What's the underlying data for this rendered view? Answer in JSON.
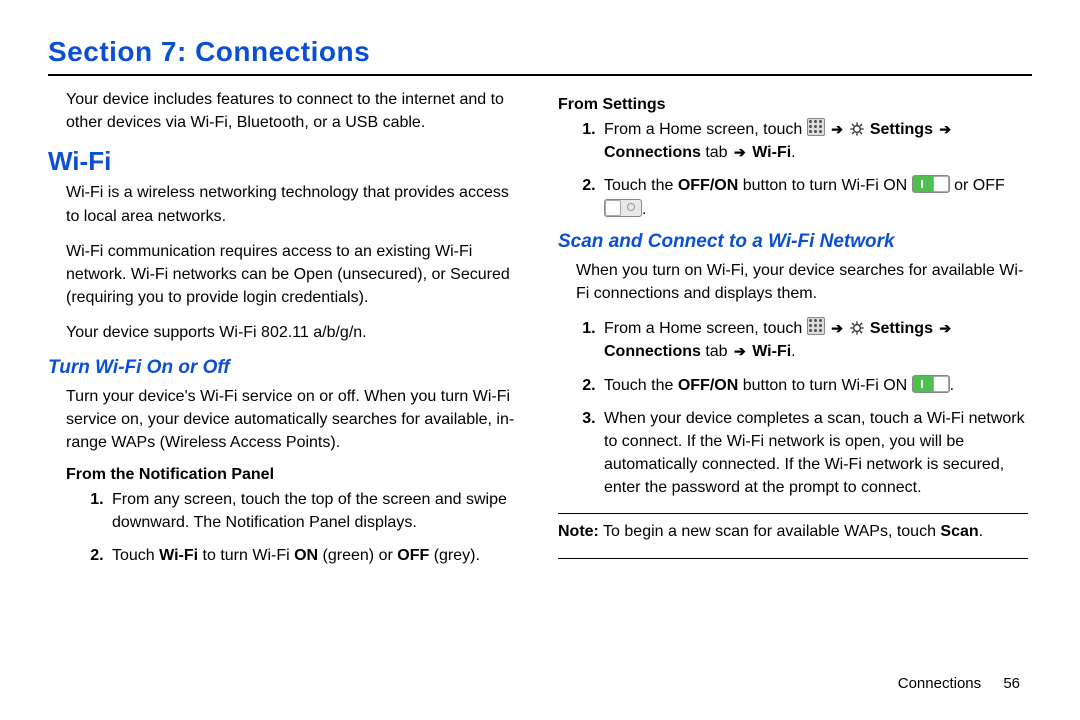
{
  "header": {
    "title": "Section 7: Connections"
  },
  "left": {
    "intro": "Your device includes features to connect to the internet and to other devices via Wi-Fi, Bluetooth, or a USB cable.",
    "wifi_heading": "Wi-Fi",
    "wifi_p1": "Wi-Fi is a wireless networking technology that provides access to local area networks.",
    "wifi_p2": "Wi-Fi communication requires access to an existing Wi-Fi network. Wi-Fi networks can be Open (unsecured), or Secured (requiring you to provide login credentials).",
    "wifi_p3": "Your device supports Wi-Fi 802.11 a/b/g/n.",
    "turn_heading": "Turn Wi-Fi On or Off",
    "turn_p": "Turn your device's Wi-Fi service on or off. When you turn Wi-Fi service on, your device automatically searches for available, in-range WAPs (Wireless Access Points).",
    "notif_heading": "From the Notification Panel",
    "notif_step1": "From any screen, touch the top of the screen and swipe downward. The Notification Panel displays.",
    "notif_step2_a": "Touch ",
    "notif_step2_b": "Wi-Fi",
    "notif_step2_c": " to turn Wi-Fi ",
    "notif_step2_on": "ON",
    "notif_step2_d": " (green) or ",
    "notif_step2_off": "OFF",
    "notif_step2_e": " (grey)."
  },
  "right": {
    "settings_heading": "From Settings",
    "settings_step1_a": "From a Home screen, touch ",
    "settings_step1_b": " Settings ",
    "settings_step1_c2": "Connections",
    "settings_step1_c3": " tab ",
    "settings_step1_d": " Wi-Fi",
    "settings_step2_a": "Touch the ",
    "settings_step2_b": "OFF/ON",
    "settings_step2_c": " button to turn Wi-Fi ON ",
    "settings_step2_d": " or OFF ",
    "scan_heading": "Scan and Connect to a Wi-Fi Network",
    "scan_p": "When you turn on Wi-Fi, your device searches for available Wi-Fi connections and displays them.",
    "scan_step1_a": "From a Home screen, touch ",
    "scan_step1_b": " Settings ",
    "scan_step1_c2": "Connections",
    "scan_step1_c3": " tab ",
    "scan_step1_d": " Wi-Fi",
    "scan_step2_a": "Touch the ",
    "scan_step2_b": "OFF/ON",
    "scan_step2_c": " button to turn Wi-Fi ON ",
    "scan_step3": "When your device completes a scan, touch a Wi-Fi network to connect. If the Wi-Fi network is open, you will be automatically connected. If the Wi-Fi network is secured, enter the password at the prompt to connect.",
    "note_a": "Note:",
    "note_b": " To begin a new scan for available WAPs, touch ",
    "note_c": "Scan"
  },
  "footer": {
    "chapter": "Connections",
    "page": "56"
  }
}
